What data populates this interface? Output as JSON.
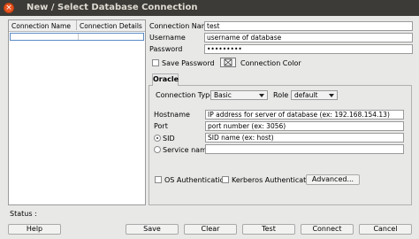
{
  "window": {
    "title": "New / Select Database Connection",
    "close_glyph": "×"
  },
  "list": {
    "columns": [
      "Connection Name",
      "Connection Details"
    ]
  },
  "form": {
    "connection_name_label": "Connection Name",
    "connection_name_value": "test",
    "username_label": "Username",
    "username_value": "username of database",
    "password_label": "Password",
    "password_value": "•••••••••",
    "save_password_label": "Save Password",
    "connection_color_label": "Connection Color"
  },
  "tab": {
    "label": "Oracle"
  },
  "oracle": {
    "connection_type_label": "Connection Type",
    "connection_type_value": "Basic",
    "role_label": "Role",
    "role_value": "default",
    "hostname_label": "Hostname",
    "hostname_value": "IP address for server of database (ex: 192.168.154.13)",
    "port_label": "Port",
    "port_value": "port number (ex: 3056)",
    "sid_label": "SID",
    "sid_value": "SID name (ex: host)",
    "service_name_label": "Service name",
    "os_auth_label": "OS Authentication",
    "kerberos_label": "Kerberos Authentication",
    "advanced_label": "Advanced..."
  },
  "status": {
    "label": "Status :"
  },
  "buttons": {
    "help": "Help",
    "save": "Save",
    "clear": "Clear",
    "test": "Test",
    "connect": "Connect",
    "cancel": "Cancel"
  }
}
